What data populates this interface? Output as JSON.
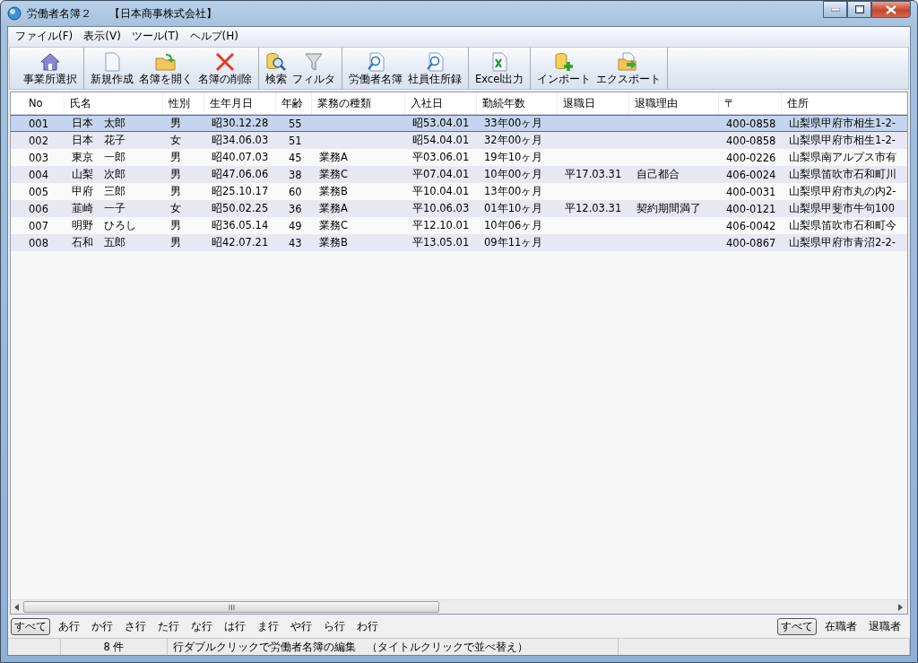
{
  "window": {
    "title": "労働者名簿２",
    "company": "【日本商事株式会社】"
  },
  "menu": [
    "ファイル(F)",
    "表示(V)",
    "ツール(T)",
    "ヘルプ(H)"
  ],
  "toolbar": [
    [
      "事業所選択"
    ],
    [
      "新規作成",
      "名簿を開く",
      "名簿の削除"
    ],
    [
      "検索",
      "フィルタ"
    ],
    [
      "労働者名簿",
      "社員住所録"
    ],
    [
      "Excel出力"
    ],
    [
      "インポート",
      "エクスポート"
    ]
  ],
  "table": {
    "columns": [
      "No",
      "氏名",
      "性別",
      "生年月日",
      "年齢",
      "業務の種類",
      "入社日",
      "勤続年数",
      "退職日",
      "退職理由",
      "〒",
      "住所"
    ],
    "rows": [
      {
        "selected": true,
        "cells": [
          "001",
          "日本　太郎",
          "男",
          "昭30.12.28",
          "55",
          "",
          "昭53.04.01",
          "33年00ヶ月",
          "",
          "",
          "400-0858",
          "山梨県甲府市相生1-2-"
        ]
      },
      {
        "selected": false,
        "cells": [
          "002",
          "日本　花子",
          "女",
          "昭34.06.03",
          "51",
          "",
          "昭54.04.01",
          "32年00ヶ月",
          "",
          "",
          "400-0858",
          "山梨県甲府市相生1-2-"
        ]
      },
      {
        "selected": false,
        "cells": [
          "003",
          "東京　一郎",
          "男",
          "昭40.07.03",
          "45",
          "業務A",
          "平03.06.01",
          "19年10ヶ月",
          "",
          "",
          "400-0226",
          "山梨県南アルプス市有"
        ]
      },
      {
        "selected": false,
        "cells": [
          "004",
          "山梨　次郎",
          "男",
          "昭47.06.06",
          "38",
          "業務C",
          "平07.04.01",
          "10年00ヶ月",
          "平17.03.31",
          "自己都合",
          "406-0024",
          "山梨県笛吹市石和町川"
        ]
      },
      {
        "selected": false,
        "cells": [
          "005",
          "甲府　三郎",
          "男",
          "昭25.10.17",
          "60",
          "業務B",
          "平10.04.01",
          "13年00ヶ月",
          "",
          "",
          "400-0031",
          "山梨県甲府市丸の内2-"
        ]
      },
      {
        "selected": false,
        "cells": [
          "006",
          "韮崎　一子",
          "女",
          "昭50.02.25",
          "36",
          "業務A",
          "平10.06.03",
          "01年10ヶ月",
          "平12.03.31",
          "契約期間満了",
          "400-0121",
          "山梨県甲斐市牛句100"
        ]
      },
      {
        "selected": false,
        "cells": [
          "007",
          "明野　ひろし",
          "男",
          "昭36.05.14",
          "49",
          "業務C",
          "平12.10.01",
          "10年06ヶ月",
          "",
          "",
          "406-0042",
          "山梨県笛吹市石和町今"
        ]
      },
      {
        "selected": false,
        "cells": [
          "008",
          "石和　五郎",
          "男",
          "昭42.07.21",
          "43",
          "業務B",
          "平13.05.01",
          "09年11ヶ月",
          "",
          "",
          "400-0867",
          "山梨県甲府市青沼2-2-"
        ]
      }
    ]
  },
  "kana_filter": [
    {
      "label": "すべて",
      "selected": true
    },
    {
      "label": "あ行",
      "selected": false
    },
    {
      "label": "か行",
      "selected": false
    },
    {
      "label": "さ行",
      "selected": false
    },
    {
      "label": "た行",
      "selected": false
    },
    {
      "label": "な行",
      "selected": false
    },
    {
      "label": "は行",
      "selected": false
    },
    {
      "label": "ま行",
      "selected": false
    },
    {
      "label": "や行",
      "selected": false
    },
    {
      "label": "ら行",
      "selected": false
    },
    {
      "label": "わ行",
      "selected": false
    }
  ],
  "status_filter": [
    {
      "label": "すべて",
      "selected": true
    },
    {
      "label": "在職者",
      "selected": false
    },
    {
      "label": "退職者",
      "selected": false
    }
  ],
  "status_bar": {
    "count": "8 件",
    "message": "行ダブルクリックで労働者名簿の編集　（タイトルクリックで並べ替え）"
  }
}
